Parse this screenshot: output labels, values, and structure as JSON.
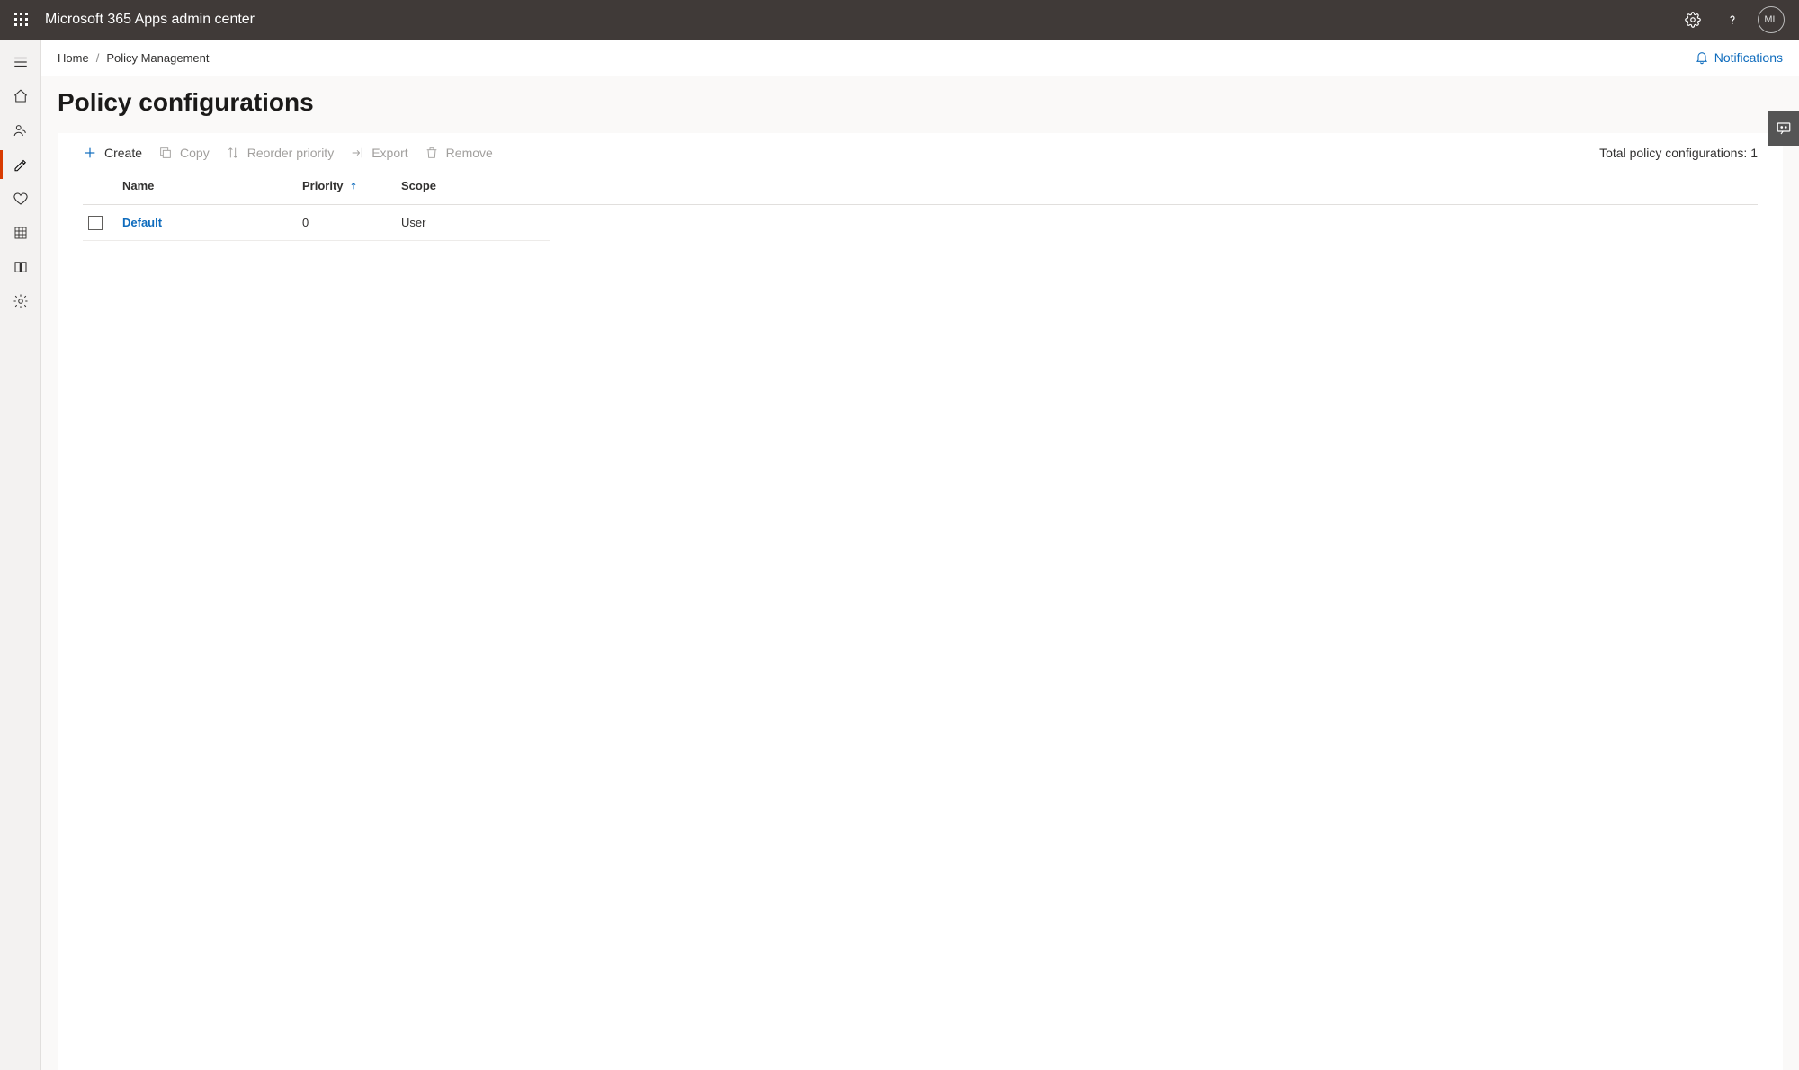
{
  "header": {
    "app_title": "Microsoft 365 Apps admin center",
    "user_initials": "ML"
  },
  "breadcrumb": {
    "home": "Home",
    "current": "Policy Management"
  },
  "notifications_label": "Notifications",
  "page_title": "Policy configurations",
  "toolbar": {
    "create": "Create",
    "copy": "Copy",
    "reorder": "Reorder priority",
    "export": "Export",
    "remove": "Remove",
    "total_label": "Total policy configurations:",
    "total_count": "1"
  },
  "table": {
    "columns": {
      "name": "Name",
      "priority": "Priority",
      "scope": "Scope"
    },
    "rows": [
      {
        "name": "Default",
        "priority": "0",
        "scope": "User"
      }
    ]
  }
}
